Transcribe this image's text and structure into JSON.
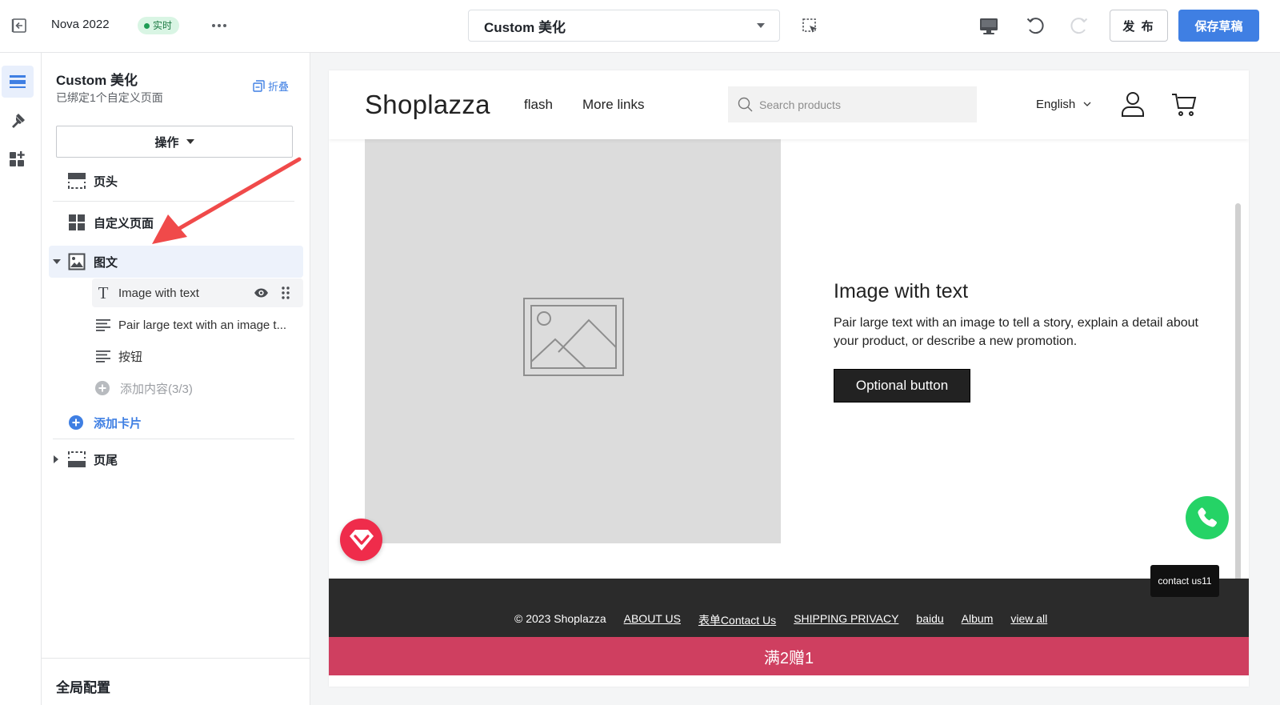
{
  "topbar": {
    "theme_name": "Nova 2022",
    "live_badge": "实时",
    "page_select": "Custom 美化",
    "publish_label": "发 布",
    "save_label": "保存草稿"
  },
  "panel": {
    "title": "Custom 美化",
    "subtitle": "已绑定1个自定义页面",
    "collapse_label": "折叠",
    "ops_label": "操作",
    "tree": {
      "header": "页头",
      "custom_page": "自定义页面",
      "image_text": "图文",
      "block_heading": "Image with text",
      "block_text": "Pair large text with an image t...",
      "block_button": "按钮",
      "add_content": "添加内容(3/3)",
      "add_card": "添加卡片",
      "footer": "页尾"
    },
    "global_config": "全局配置"
  },
  "preview": {
    "logo": "Shoplazza",
    "nav": [
      "flash",
      "More links"
    ],
    "search_placeholder": "Search products",
    "language": "English",
    "section": {
      "heading": "Image with text",
      "body": "Pair large text with an image to tell a story, explain a detail about your product, or describe a new promotion.",
      "button": "Optional button"
    },
    "contact_tip": "contact us11",
    "footer": {
      "copyright": "© 2023 Shoplazza",
      "links": [
        "ABOUT US",
        "表单Contact Us",
        "SHIPPING PRIVACY",
        "baidu",
        "Album",
        "view all"
      ]
    },
    "promo": "满2赠1"
  },
  "colors": {
    "primary": "#3f7fe3",
    "live_green": "#1f9d55",
    "promo": "#cf3f60",
    "annotation_arrow": "#f04a4a",
    "whatsapp": "#25d366",
    "badge_red": "#ef2c4b"
  },
  "icons": {
    "exit": "exit-icon",
    "more": "more-icon",
    "select_tool": "select-tool-icon",
    "desktop": "desktop-icon",
    "undo": "undo-icon",
    "redo": "redo-icon",
    "rail": [
      "sections-icon",
      "theme-style-icon",
      "apps-icon"
    ],
    "eye": "eye-icon",
    "drag": "drag-handle-icon"
  }
}
